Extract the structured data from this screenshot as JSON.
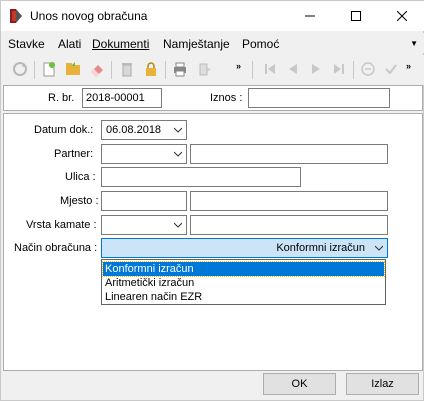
{
  "window": {
    "title": "Unos novog obračuna",
    "minimize_glyph": "—",
    "maximize_glyph": "☐",
    "close_glyph": "✕"
  },
  "menu": {
    "items": [
      {
        "label": "Stavke"
      },
      {
        "label": "Alati"
      },
      {
        "label": "Dokumenti"
      },
      {
        "label": "Namještanje"
      },
      {
        "label": "Pomoć"
      }
    ],
    "overflow": "▼"
  },
  "toolbar": {
    "icons": [
      "refresh-icon",
      "new-document-icon",
      "folder-icon",
      "eraser-icon",
      "delete-icon",
      "lock-icon",
      "print-icon",
      "export-icon",
      "first-icon",
      "previous-icon",
      "next-icon",
      "last-icon",
      "cancel-icon",
      "confirm-icon"
    ],
    "overflow": "»"
  },
  "header": {
    "rbr_label": "R. br.",
    "rbr_value": "2018-00001",
    "iznos_label": "Iznos :",
    "iznos_value": ""
  },
  "form": {
    "datum_label": "Datum dok.:",
    "datum_value": "06.08.2018",
    "partner_label": "Partner:",
    "partner_code": "",
    "partner_name": "",
    "ulica_label": "Ulica :",
    "ulica_value": "",
    "mjesto_label": "Mjesto :",
    "mjesto_code": "",
    "mjesto_name": "",
    "vrsta_label": "Vrsta kamate :",
    "vrsta_code": "",
    "vrsta_name": "",
    "nacin_label": "Način obračuna :",
    "nacin_value": "Konformni izračun"
  },
  "dropdown": {
    "options": [
      {
        "label": "Konformni izračun"
      },
      {
        "label": "Aritmetički izračun"
      },
      {
        "label": "Linearen način EZR"
      }
    ]
  },
  "buttons": {
    "ok": "OK",
    "cancel": "Izlaz"
  }
}
